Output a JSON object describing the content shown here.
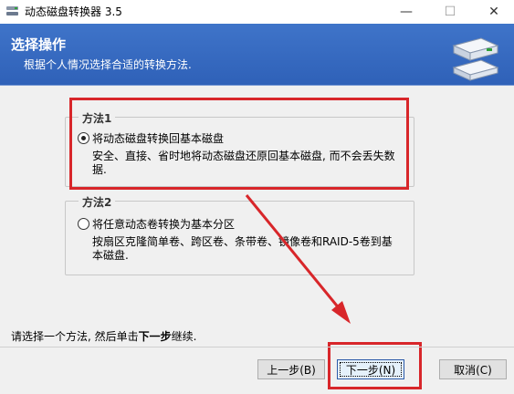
{
  "window": {
    "title": "动态磁盘转换器 3.5",
    "minimize_glyph": "—",
    "maximize_glyph": "☐",
    "close_glyph": "✕"
  },
  "banner": {
    "title": "选择操作",
    "subtitle": "根据个人情况选择合适的转换方法."
  },
  "options": [
    {
      "legend": "方法1",
      "label": "将动态磁盘转换回基本磁盘",
      "description": "安全、直接、省时地将动态磁盘还原回基本磁盘, 而不会丢失数据.",
      "selected": true
    },
    {
      "legend": "方法2",
      "label": "将任意动态卷转换为基本分区",
      "description": "按扇区克隆简单卷、跨区卷、条带卷、镜像卷和RAID-5卷到基本磁盘.",
      "selected": false
    }
  ],
  "instruction": {
    "prefix": "请选择一个方法, 然后单击",
    "emphasis": "下一步",
    "suffix": "继续."
  },
  "buttons": {
    "prev": "上一步(B)",
    "next": "下一步(N)",
    "cancel": "取消(C)"
  },
  "colors": {
    "banner": "#2f61b8",
    "highlight": "#d8262a"
  }
}
